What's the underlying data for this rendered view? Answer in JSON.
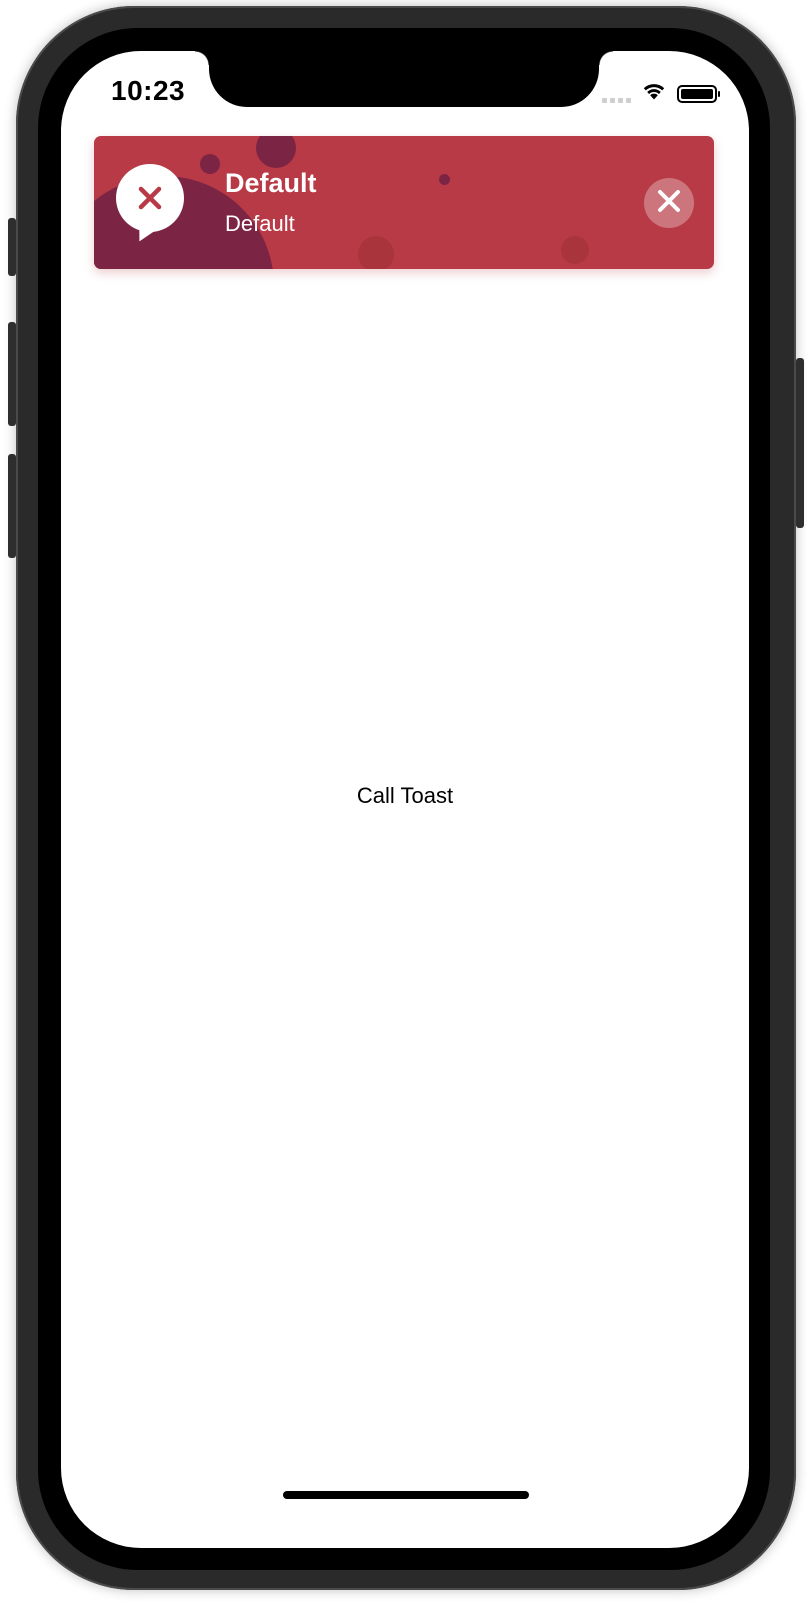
{
  "status_bar": {
    "time": "10:23",
    "wifi_icon": "wifi-icon",
    "battery_icon": "battery-icon",
    "battery_level": 1.0
  },
  "toast": {
    "title": "Default",
    "message": "Default",
    "type_icon": "error-x-icon",
    "close_icon": "close-icon",
    "colors": {
      "background": "#b83a46",
      "accent": "#7c2443"
    }
  },
  "main": {
    "call_toast_label": "Call Toast"
  }
}
